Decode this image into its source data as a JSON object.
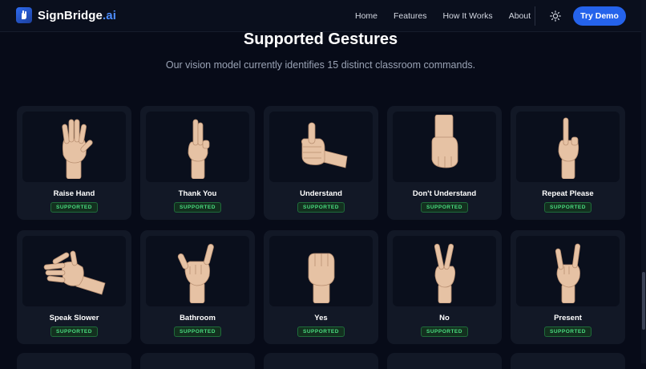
{
  "brand": {
    "name": "SignBridge",
    "suffix": ".ai",
    "logo_icon": "sign-hand-logo-icon"
  },
  "nav": {
    "links": [
      "Home",
      "Features",
      "How It Works",
      "About"
    ],
    "theme_icon": "sun-icon",
    "cta": "Try Demo"
  },
  "section": {
    "title": "Supported Gestures",
    "subtitle": "Our vision model currently identifies 15 distinct classroom commands."
  },
  "gestures": [
    {
      "label": "Raise Hand",
      "status": "SUPPORTED",
      "icon": "open-palm-hand-icon"
    },
    {
      "label": "Thank You",
      "status": "SUPPORTED",
      "icon": "two-fingers-hand-icon"
    },
    {
      "label": "Understand",
      "status": "SUPPORTED",
      "icon": "thumbs-up-hand-icon"
    },
    {
      "label": "Don't Understand",
      "status": "SUPPORTED",
      "icon": "fist-down-hand-icon"
    },
    {
      "label": "Repeat Please",
      "status": "SUPPORTED",
      "icon": "index-up-hand-icon"
    },
    {
      "label": "Speak Slower",
      "status": "SUPPORTED",
      "icon": "flat-palm-hand-icon"
    },
    {
      "label": "Bathroom",
      "status": "SUPPORTED",
      "icon": "shaka-hand-icon"
    },
    {
      "label": "Yes",
      "status": "SUPPORTED",
      "icon": "closed-fist-hand-icon"
    },
    {
      "label": "No",
      "status": "SUPPORTED",
      "icon": "peace-sign-hand-icon"
    },
    {
      "label": "Present",
      "status": "SUPPORTED",
      "icon": "rock-sign-hand-icon"
    }
  ],
  "colors": {
    "background": "#070b18",
    "card": "#121826",
    "accent": "#2563eb",
    "badge_text": "#4ade80",
    "skin": "#e6c2a4"
  }
}
